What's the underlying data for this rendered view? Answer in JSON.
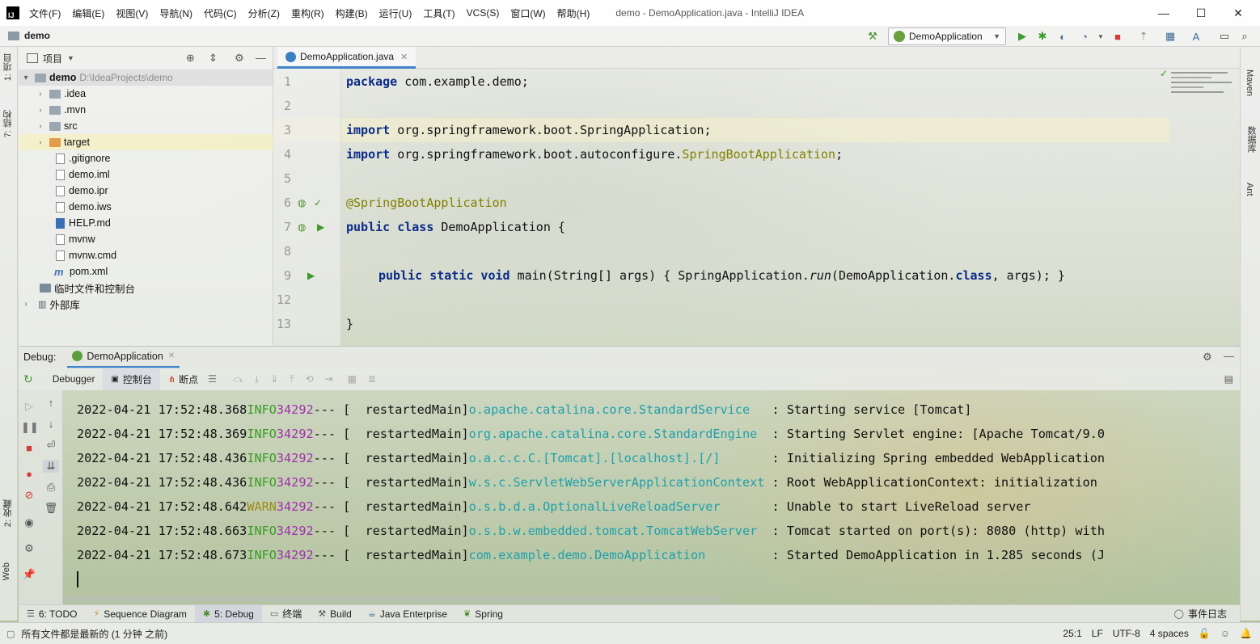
{
  "window": {
    "app_logo": "IJ",
    "title": "demo - DemoApplication.java - IntelliJ IDEA",
    "menu": [
      "文件(F)",
      "编辑(E)",
      "视图(V)",
      "导航(N)",
      "代码(C)",
      "分析(Z)",
      "重构(R)",
      "构建(B)",
      "运行(U)",
      "工具(T)",
      "VCS(S)",
      "窗口(W)",
      "帮助(H)"
    ],
    "controls": {
      "minimize": "—",
      "maximize": "☐",
      "close": "✕"
    }
  },
  "navbar": {
    "project": "demo",
    "run_config": "DemoApplication"
  },
  "left_strip": {
    "project_tab": "1: 项目",
    "structure_tab": "7: 结构",
    "favorites_tab": "2: 收藏",
    "web_tab": "Web"
  },
  "right_strip": {
    "maven": "Maven",
    "database": "数据库",
    "ant": "Ant"
  },
  "project_panel": {
    "title": "项目",
    "root": {
      "name": "demo",
      "path": "D:\\IdeaProjects\\demo"
    },
    "items": [
      {
        "name": ".idea",
        "type": "folder"
      },
      {
        "name": ".mvn",
        "type": "folder"
      },
      {
        "name": "src",
        "type": "folder"
      },
      {
        "name": "target",
        "type": "folder-orange"
      },
      {
        "name": ".gitignore",
        "type": "file"
      },
      {
        "name": "demo.iml",
        "type": "file"
      },
      {
        "name": "demo.ipr",
        "type": "file"
      },
      {
        "name": "demo.iws",
        "type": "file"
      },
      {
        "name": "HELP.md",
        "type": "md"
      },
      {
        "name": "mvnw",
        "type": "file"
      },
      {
        "name": "mvnw.cmd",
        "type": "file"
      },
      {
        "name": "pom.xml",
        "type": "xml"
      }
    ],
    "scratches": "临时文件和控制台",
    "external_libs": "外部库"
  },
  "editor": {
    "tab": "DemoApplication.java",
    "line_numbers": [
      "1",
      "2",
      "3",
      "4",
      "5",
      "6",
      "7",
      "8",
      "9",
      "12",
      "13"
    ],
    "lines": [
      {
        "kw": "package",
        "text": " com.example.demo;"
      },
      {
        "kw": "",
        "text": ""
      },
      {
        "kw": "import",
        "text": " org.springframework.boot.SpringApplication;"
      },
      {
        "kw": "import",
        "text": " org.springframework.boot.autoconfigure.",
        "ann": "SpringBootApplication",
        "tail": ";"
      },
      {
        "kw": "",
        "text": ""
      },
      {
        "ann": "@SpringBootApplication"
      },
      {
        "kw": "public class",
        "text": " DemoApplication {"
      },
      {
        "kw": "",
        "text": ""
      },
      {
        "kw": "public static void",
        "text": " main(String[] args) { SpringApplication.",
        "italic": "run",
        "tail": "(DemoApplication.",
        "kw2": "class",
        "tail2": ", args); }"
      },
      {
        "kw": "",
        "text": ""
      },
      {
        "kw": "",
        "text": "}"
      }
    ]
  },
  "debug": {
    "label": "Debug:",
    "tab": "DemoApplication",
    "subtabs": {
      "debugger": "Debugger",
      "console": "控制台",
      "breakpoints": "断点"
    },
    "logs": [
      {
        "ts": "2022-04-21 17:52:48.368",
        "level": "INFO",
        "pid": "34292",
        "sep": "--- [",
        "thread": "  restartedMain]",
        "logger": "o.apache.catalina.core.StandardService  ",
        "msg": " : Starting service [Tomcat]"
      },
      {
        "ts": "2022-04-21 17:52:48.369",
        "level": "INFO",
        "pid": "34292",
        "sep": "--- [",
        "thread": "  restartedMain]",
        "logger": "org.apache.catalina.core.StandardEngine ",
        "msg": " : Starting Servlet engine: [Apache Tomcat/9.0"
      },
      {
        "ts": "2022-04-21 17:52:48.436",
        "level": "INFO",
        "pid": "34292",
        "sep": "--- [",
        "thread": "  restartedMain]",
        "logger": "o.a.c.c.C.[Tomcat].[localhost].[/]      ",
        "msg": " : Initializing Spring embedded WebApplication"
      },
      {
        "ts": "2022-04-21 17:52:48.436",
        "level": "INFO",
        "pid": "34292",
        "sep": "--- [",
        "thread": "  restartedMain]",
        "logger": "w.s.c.ServletWebServerApplicationContext",
        "msg": " : Root WebApplicationContext: initialization"
      },
      {
        "ts": "2022-04-21 17:52:48.642",
        "level": "WARN",
        "pid": "34292",
        "sep": "--- [",
        "thread": "  restartedMain]",
        "logger": "o.s.b.d.a.OptionalLiveReloadServer      ",
        "msg": " : Unable to start LiveReload server"
      },
      {
        "ts": "2022-04-21 17:52:48.663",
        "level": "INFO",
        "pid": "34292",
        "sep": "--- [",
        "thread": "  restartedMain]",
        "logger": "o.s.b.w.embedded.tomcat.TomcatWebServer ",
        "msg": " : Tomcat started on port(s): 8080 (http) with"
      },
      {
        "ts": "2022-04-21 17:52:48.673",
        "level": "INFO",
        "pid": "34292",
        "sep": "--- [",
        "thread": "  restartedMain]",
        "logger": "com.example.demo.DemoApplication        ",
        "msg": " : Started DemoApplication in 1.285 seconds (J"
      }
    ]
  },
  "bottom_tabs": [
    {
      "label": "6: TODO",
      "icon": "list-icon"
    },
    {
      "label": "Sequence Diagram",
      "icon": "diagram-icon"
    },
    {
      "label": "5: Debug",
      "icon": "bug-icon"
    },
    {
      "label": "终端",
      "icon": "terminal-icon"
    },
    {
      "label": "Build",
      "icon": "hammer-icon"
    },
    {
      "label": "Java Enterprise",
      "icon": "enterprise-icon"
    },
    {
      "label": "Spring",
      "icon": "spring-icon"
    }
  ],
  "event_log": "事件日志",
  "status": {
    "message": "所有文件都是最新的 (1 分钟 之前)",
    "position": "25:1",
    "line_sep": "LF",
    "encoding": "UTF-8",
    "indent": "4 spaces"
  }
}
